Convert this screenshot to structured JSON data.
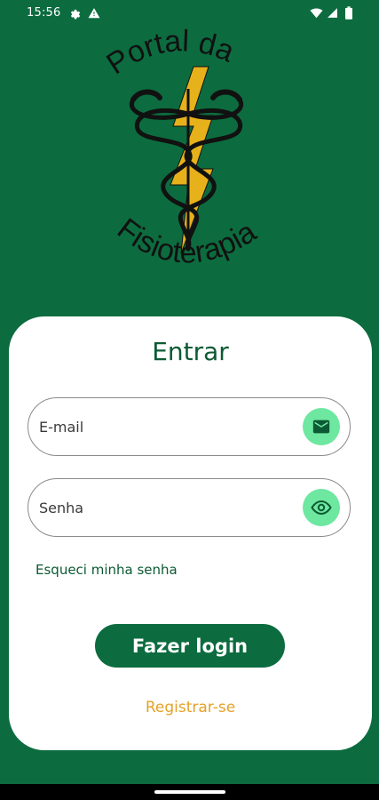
{
  "status_bar": {
    "time": "15:56",
    "icons": [
      "gear-icon",
      "alert-icon",
      "wifi-icon",
      "signal-icon",
      "battery-icon"
    ]
  },
  "logo": {
    "line1": "Portal da",
    "line2": "Fisioterapia",
    "icons": [
      "caduceus-icon",
      "lightning-bolt-icon"
    ],
    "colors": {
      "bolt": "#e7b11b",
      "snake": "#111111"
    }
  },
  "login_card": {
    "title": "Entrar",
    "email_field": {
      "placeholder": "E-mail",
      "value": "",
      "icon": "mail-icon"
    },
    "password_field": {
      "placeholder": "Senha",
      "value": "",
      "icon": "eye-icon"
    },
    "forgot_password": "Esqueci minha senha",
    "login_button": "Fazer login",
    "register_link": "Registrar-se"
  },
  "colors": {
    "background": "#0c6c3f",
    "primary_text": "#0c5a33",
    "icon_bubble": "#6ee7a0",
    "register_link": "#e4a227",
    "card": "#ffffff"
  }
}
